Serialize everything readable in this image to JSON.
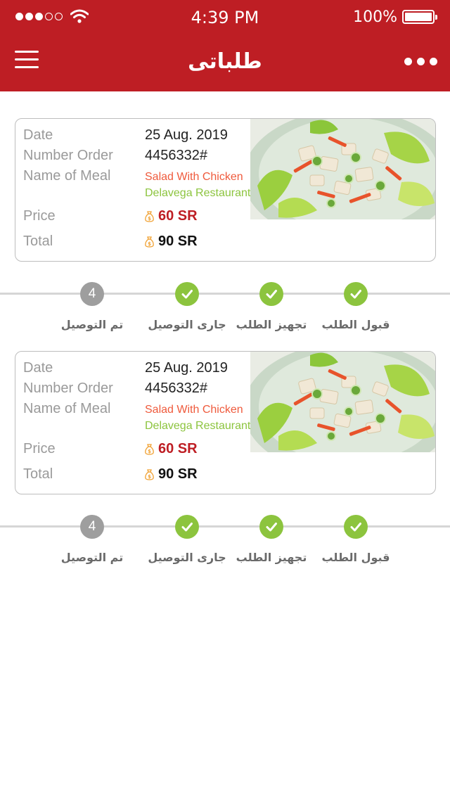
{
  "status_bar": {
    "time": "4:39 PM",
    "battery": "100%",
    "signal_dots": [
      true,
      true,
      true,
      false,
      false
    ]
  },
  "header": {
    "title": "طلباتى",
    "menu_icon": "hamburger-icon",
    "more_icon": "more-dots-icon"
  },
  "colors": {
    "brand": "#be1e24",
    "meal_name": "#ef5a3c",
    "restaurant": "#8cc43e",
    "step_done": "#8cc43e",
    "step_pending": "#9e9e9e"
  },
  "orders": [
    {
      "labels": {
        "date": "Date",
        "number": "Number Order",
        "meal": "Name of Meal",
        "price": "Price",
        "total": "Total"
      },
      "date": "25 Aug. 2019",
      "number": "4456332#",
      "meal_name": "Salad With Chicken",
      "restaurant": "Delavega Restaurant",
      "price": "60 SR",
      "total": "90 SR",
      "steps": [
        {
          "label": "قبول الطلب",
          "done": true
        },
        {
          "label": "تجهيز الطلب",
          "done": true
        },
        {
          "label": "جارى التوصيل",
          "done": true
        },
        {
          "label": "تم التوصيل",
          "done": false,
          "number": "4"
        }
      ]
    },
    {
      "labels": {
        "date": "Date",
        "number": "Number Order",
        "meal": "Name of Meal",
        "price": "Price",
        "total": "Total"
      },
      "date": "25 Aug. 2019",
      "number": "4456332#",
      "meal_name": "Salad With Chicken",
      "restaurant": "Delavega Restaurant",
      "price": "60 SR",
      "total": "90 SR",
      "steps": [
        {
          "label": "قبول الطلب",
          "done": true
        },
        {
          "label": "تجهيز الطلب",
          "done": true
        },
        {
          "label": "جارى التوصيل",
          "done": true
        },
        {
          "label": "تم التوصيل",
          "done": false,
          "number": "4"
        }
      ]
    }
  ]
}
